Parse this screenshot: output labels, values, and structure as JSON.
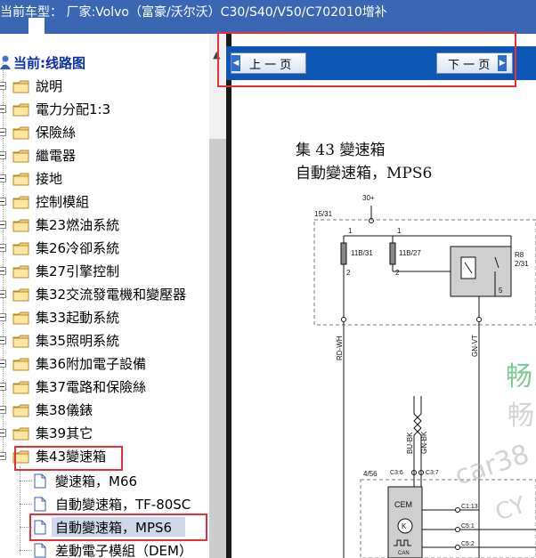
{
  "window": {
    "title": "当前车型： 厂家:Volvo（富豪/沃尔沃）C30/S40/V50/C702010增补"
  },
  "tree": {
    "root_label": "当前:线路图",
    "folders": [
      "說明",
      "電力分配1:3",
      "保險絲",
      "繼電器",
      "接地",
      "控制模組",
      "集23燃油系統",
      "集26冷卻系統",
      "集27引擎控制",
      "集32交流發電機和變壓器",
      "集33起動系統",
      "集35照明系統",
      "集36附加電子設備",
      "集37電路和保險絲",
      "集38儀錶",
      "集39其它",
      "集43變速箱"
    ],
    "docs": [
      "變速箱，M66",
      "自動變速箱，TF-80SC",
      "自動變速箱，MPS6",
      "差動電子模組（DEM）"
    ],
    "selected": "自動變速箱，MPS6"
  },
  "nav": {
    "prev_label": "上 一 页",
    "next_label": "下 一 页"
  },
  "diagram": {
    "title_line1": "集 43 變速箱",
    "title_line2": "自動變速箱，MPS6",
    "labels": {
      "supply": "30+",
      "block": "15/31",
      "fuse1": "11B/31",
      "fuse2": "11B/27",
      "relay": "R8",
      "relay_sub": "2/31",
      "wire1": "RD-WH",
      "wire2": "GN-VT",
      "wire3": "BU-BK",
      "wire4": "GN-BK",
      "module_ref": "4/56",
      "module": "CEM",
      "pin1": "C3:6",
      "pin2": "C3:7",
      "pin3": "C1:13",
      "pin4": "C5:1",
      "pin5": "C5:2",
      "can": "CAN",
      "pin_1": "1",
      "pin_2": "2",
      "pin_5": "5"
    },
    "watermark": {
      "line1": "畅",
      "line2": "畅",
      "line3": "car38",
      "line4": "CY"
    }
  },
  "colors": {
    "titlebar": "#3a66b3",
    "navbar": "#0d56b6",
    "highlight_box": "#e4313b",
    "selection": "#cfd8ea",
    "watermark": "#1aa048"
  }
}
